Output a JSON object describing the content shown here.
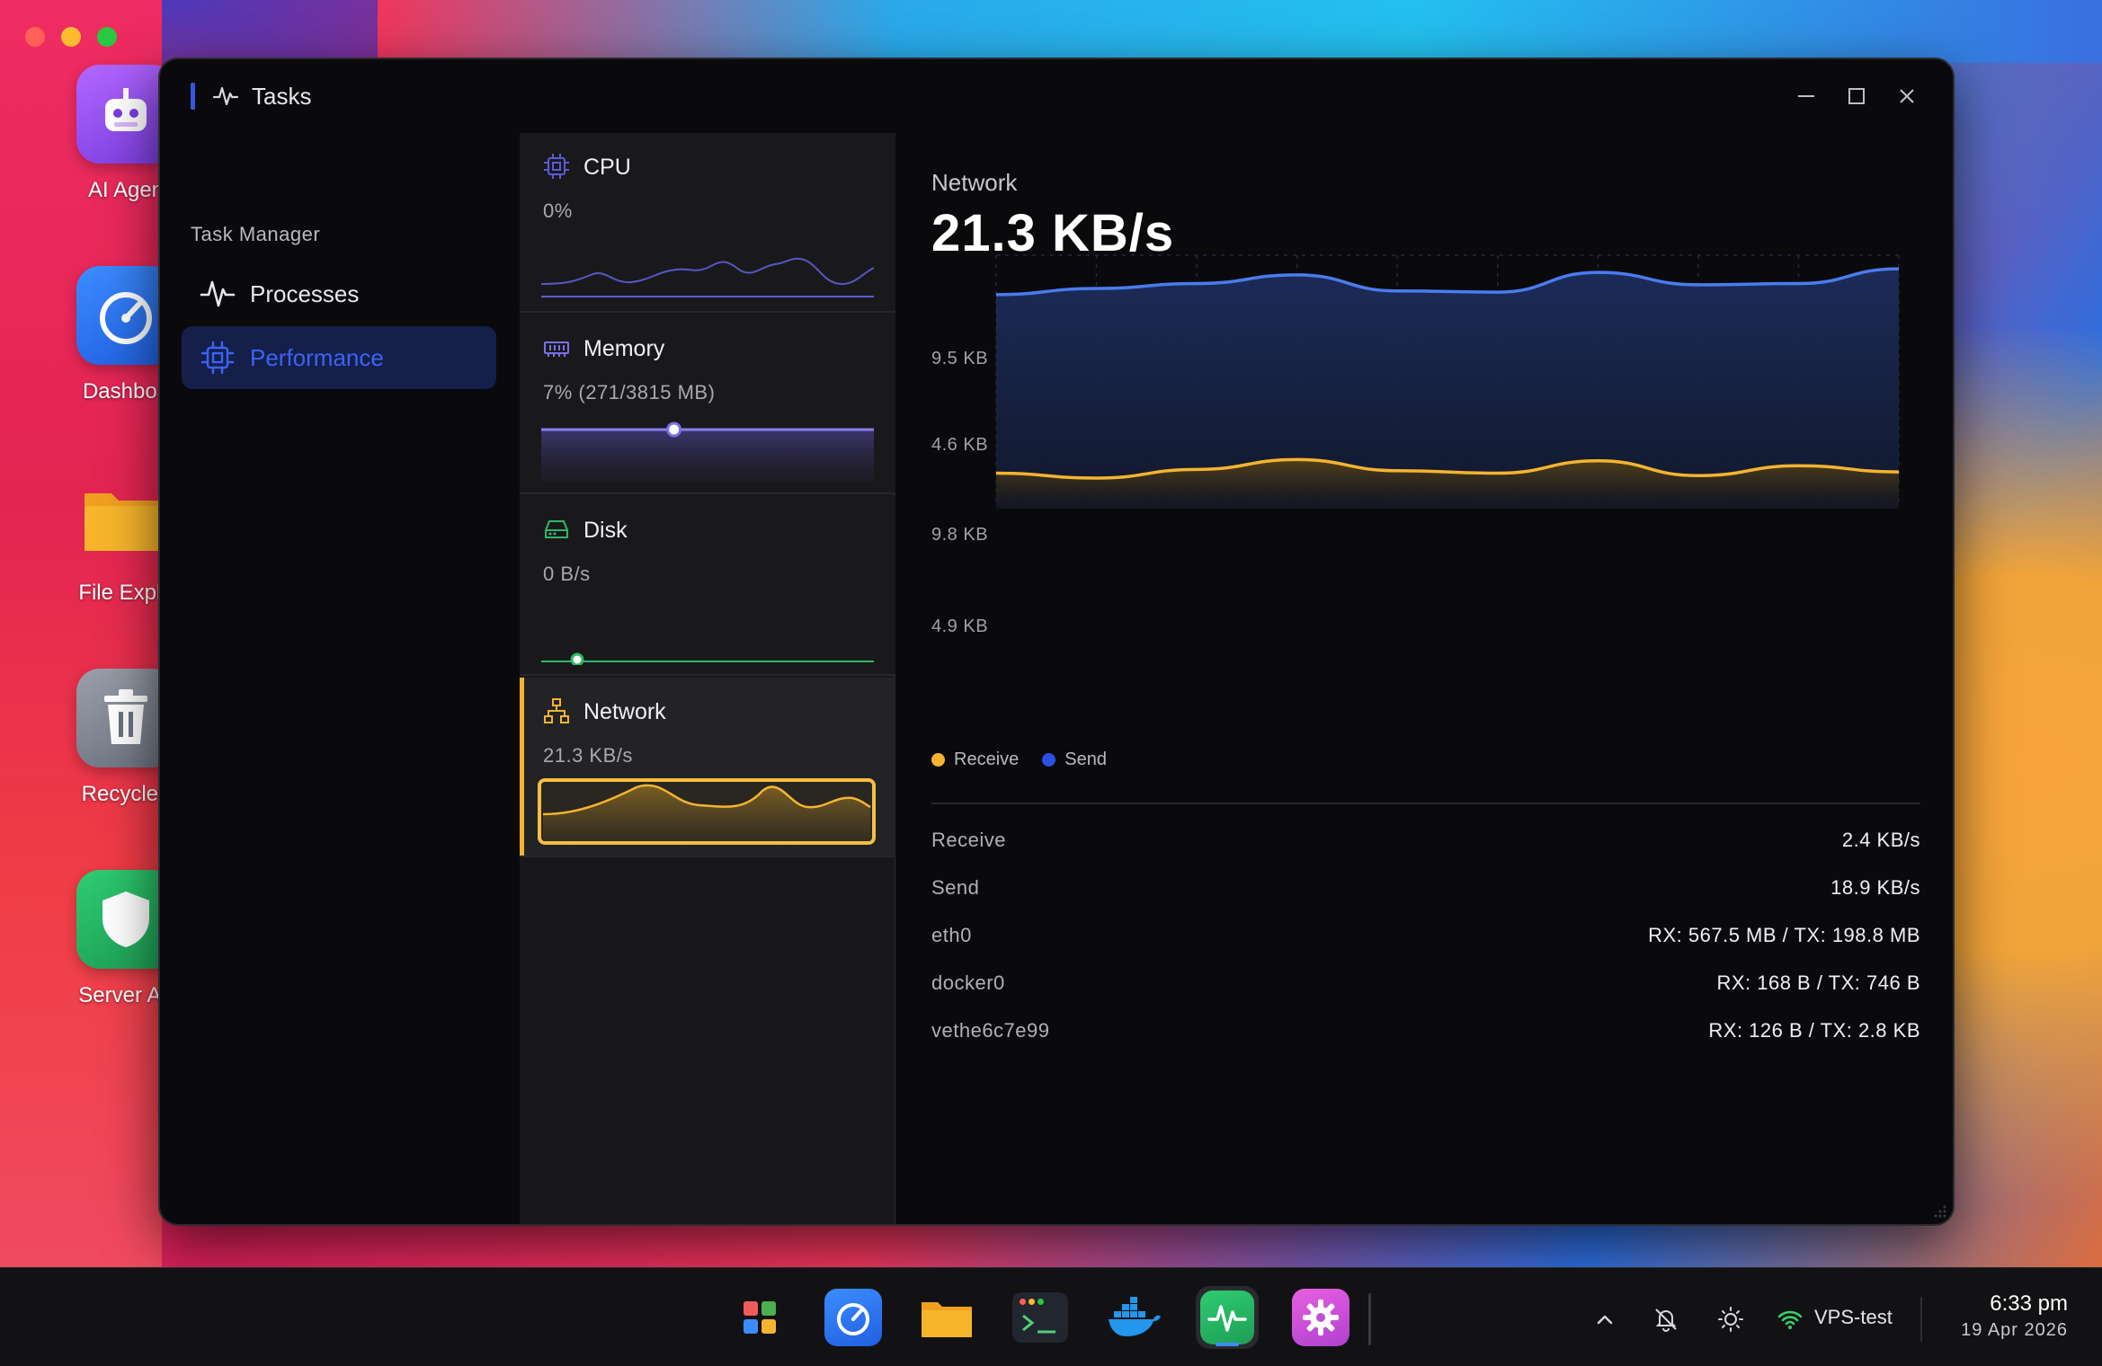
{
  "window": {
    "title": "Tasks"
  },
  "desktop": {
    "icons": [
      {
        "label": "AI Agen"
      },
      {
        "label": "Dashboa"
      },
      {
        "label": "File Explo"
      },
      {
        "label": "Recycle I"
      },
      {
        "label": "Server Ad"
      }
    ]
  },
  "sidebar": {
    "heading": "Task Manager",
    "items": [
      {
        "label": "Processes",
        "icon": "activity-icon"
      },
      {
        "label": "Performance",
        "icon": "cpu-chip-icon",
        "active": true
      }
    ]
  },
  "resources": [
    {
      "title": "CPU",
      "value": "0%",
      "icon": "cpu-chip-icon",
      "color": "#5b5bd6"
    },
    {
      "title": "Memory",
      "value": "7% (271/3815 MB)",
      "icon": "memory-icon",
      "color": "#7c6fe8",
      "fraction": 0.07
    },
    {
      "title": "Disk",
      "value": "0 B/s",
      "icon": "disk-icon",
      "color": "#2fb866"
    },
    {
      "title": "Network",
      "value": "21.3 KB/s",
      "icon": "network-icon",
      "color": "#f4b430",
      "active": true
    }
  ],
  "detail": {
    "label": "Network",
    "value": "21.3 KB/s",
    "legend": [
      {
        "name": "Receive",
        "color": "#f4b430"
      },
      {
        "name": "Send",
        "color": "#2a4fe6"
      }
    ],
    "stats": [
      {
        "key": "Receive",
        "value": "2.4 KB/s"
      },
      {
        "key": "Send",
        "value": "18.9 KB/s"
      },
      {
        "key": "eth0",
        "value": "RX: 567.5 MB / TX: 198.8 MB"
      },
      {
        "key": "docker0",
        "value": "RX: 168 B / TX: 746 B"
      },
      {
        "key": "vethe6c7e99",
        "value": "RX: 126 B / TX: 2.8 KB"
      }
    ]
  },
  "chart_data": {
    "type": "area",
    "y_tick_labels": [
      "9.5 KB",
      "4.6 KB",
      "9.8 KB",
      "4.9 KB"
    ],
    "grid": true,
    "legend_position": "bottom-left",
    "series": [
      {
        "name": "Send",
        "color": "#4a7cf0",
        "values": [
          16.8,
          17.3,
          17.7,
          18.4,
          17.1,
          17.0,
          18.6,
          17.6,
          17.7,
          18.9
        ]
      },
      {
        "name": "Receive",
        "color": "#f4b430",
        "values": [
          2.3,
          1.9,
          2.6,
          3.4,
          2.5,
          2.3,
          3.3,
          2.1,
          2.9,
          2.4
        ]
      }
    ],
    "ylim": [
      0,
      20
    ]
  },
  "taskbar": {
    "apps": [
      {
        "name": "start-menu-icon",
        "running": false
      },
      {
        "name": "dashboard-icon",
        "running": false
      },
      {
        "name": "folder-icon",
        "running": false
      },
      {
        "name": "terminal-icon",
        "running": false
      },
      {
        "name": "docker-icon",
        "running": false
      },
      {
        "name": "tasks-icon",
        "running": true
      },
      {
        "name": "settings-icon",
        "running": false
      }
    ],
    "network_name": "VPS-test",
    "time": "6:33 pm",
    "date": "19 Apr 2026"
  }
}
